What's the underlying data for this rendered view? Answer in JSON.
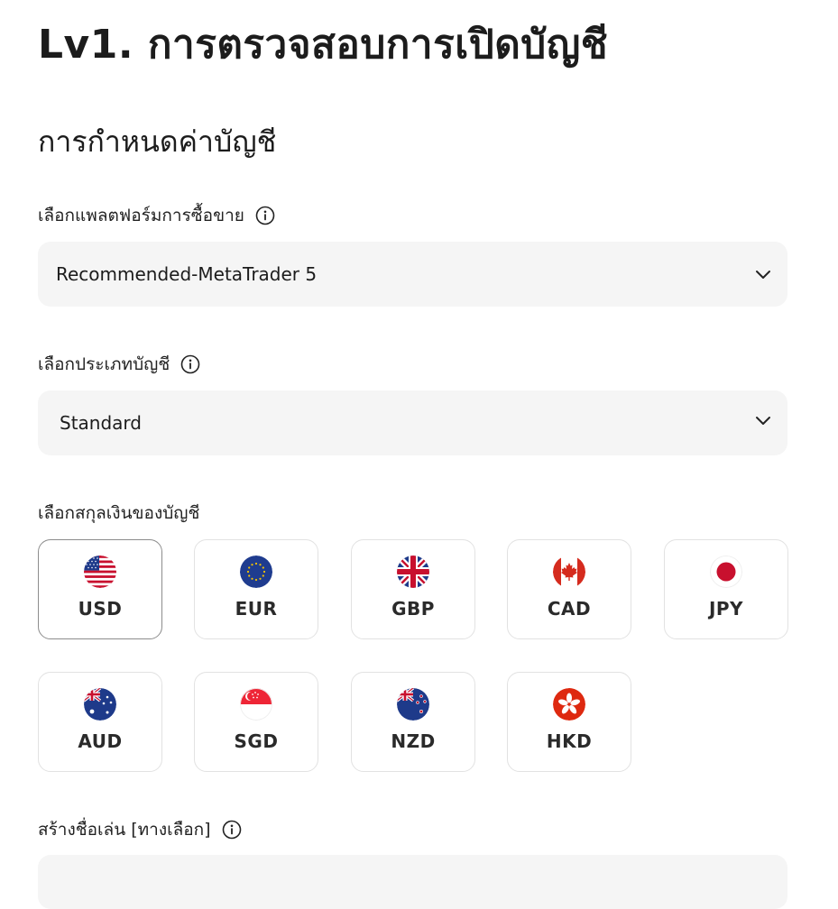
{
  "header": {
    "title": "Lv1. การตรวจสอบการเปิดบัญชี"
  },
  "section": {
    "title": "การกำหนดค่าบัญชี"
  },
  "platform": {
    "label": "เลือกแพลตฟอร์มการซื้อขาย",
    "selected": "Recommended-MetaTrader 5"
  },
  "account_type": {
    "label": "เลือกประเภทบัญชี",
    "selected": "Standard"
  },
  "currency": {
    "label": "เลือกสกุลเงินของบัญชี",
    "selected": "USD",
    "options": [
      {
        "code": "USD",
        "flag": "us-flag-icon"
      },
      {
        "code": "EUR",
        "flag": "eu-flag-icon"
      },
      {
        "code": "GBP",
        "flag": "gb-flag-icon"
      },
      {
        "code": "CAD",
        "flag": "ca-flag-icon"
      },
      {
        "code": "JPY",
        "flag": "jp-flag-icon"
      },
      {
        "code": "AUD",
        "flag": "au-flag-icon"
      },
      {
        "code": "SGD",
        "flag": "sg-flag-icon"
      },
      {
        "code": "NZD",
        "flag": "nz-flag-icon"
      },
      {
        "code": "HKD",
        "flag": "hk-flag-icon"
      }
    ]
  },
  "nickname": {
    "label": "สร้างชื่อเล่น [ทางเลือก]",
    "value": "",
    "placeholder": ""
  },
  "colors": {
    "field_bg": "#f5f5f5",
    "card_border": "#e2e2e2",
    "selected_border": "#8c8c8c"
  }
}
